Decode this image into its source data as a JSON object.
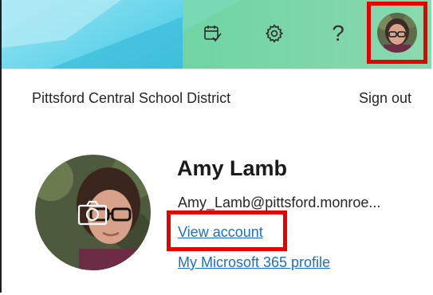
{
  "header": {
    "icons": {
      "calendar_check": "calendar-check-icon",
      "settings": "gear-icon",
      "help": "?"
    },
    "highlight_color": "#e60000"
  },
  "account_panel": {
    "org_name": "Pittsford Central School District",
    "sign_out_label": "Sign out",
    "user": {
      "name": "Amy Lamb",
      "email": "Amy_Lamb@pittsford.monroe..."
    },
    "links": {
      "view_account": "View account",
      "m365_profile": "My Microsoft 365 profile"
    },
    "link_color": "#1a6fc9"
  }
}
